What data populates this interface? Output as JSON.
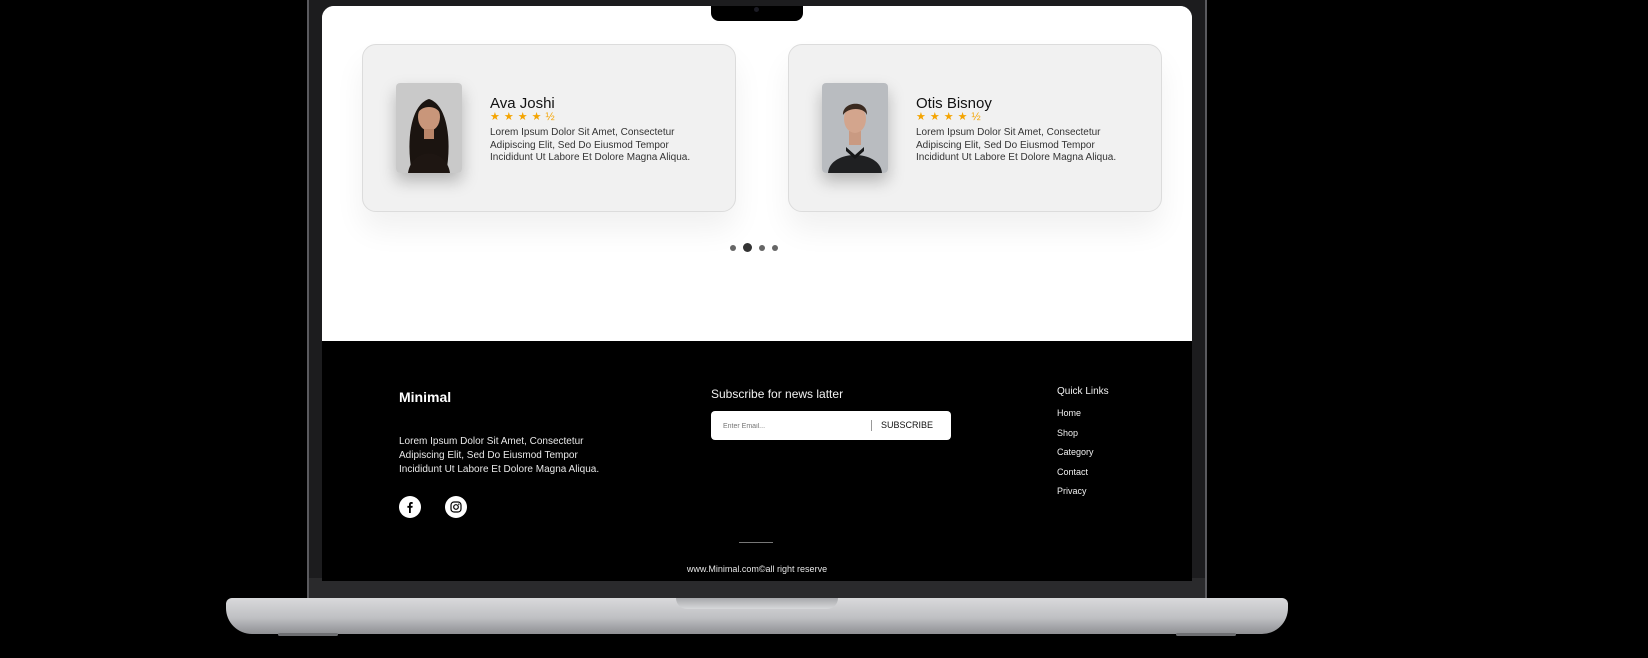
{
  "testimonials": [
    {
      "name": "Ava Joshi",
      "rating": 4.5,
      "stars": "★★★★½",
      "quote": "Lorem Ipsum Dolor Sit Amet, Consectetur Adipiscing Elit, Sed Do Eiusmod Tempor Incididunt Ut Labore Et Dolore Magna Aliqua."
    },
    {
      "name": "Otis Bisnoy",
      "rating": 4.5,
      "stars": "★★★★½",
      "quote": "Lorem Ipsum Dolor Sit Amet, Consectetur Adipiscing Elit, Sed Do Eiusmod Tempor Incididunt Ut Labore Et Dolore Magna Aliqua."
    }
  ],
  "carousel": {
    "total": 4,
    "active": 2
  },
  "footer": {
    "brand": "Minimal",
    "about": "Lorem Ipsum Dolor Sit Amet, Consectetur Adipiscing Elit, Sed Do Eiusmod Tempor Incididunt Ut Labore Et Dolore Magna Aliqua.",
    "social": [
      "facebook-icon",
      "instagram-icon"
    ],
    "subscribe_title": "Subscribe for news latter",
    "email_placeholder": "Enter Email...",
    "subscribe_button": "SUBSCRIBE",
    "quick_links_title": "Quick Links",
    "quick_links": [
      "Home",
      "Shop",
      "Category",
      "Contact",
      "Privacy"
    ],
    "copyright": "www.Minimal.com©all right reserve"
  },
  "colors": {
    "star": "#f4a400",
    "footer_bg": "#000000",
    "card_bg": "#f1f1f1"
  }
}
